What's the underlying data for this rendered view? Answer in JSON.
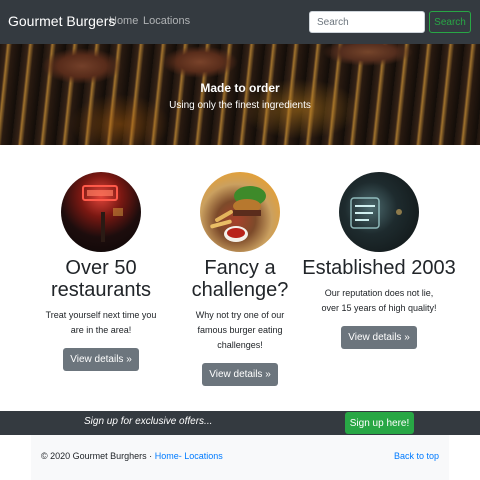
{
  "navbar": {
    "brand": "Gourmet Burgers",
    "links": [
      "Home",
      "Locations"
    ],
    "search": {
      "placeholder": "Search",
      "button_label": "Search"
    }
  },
  "hero": {
    "title": "Made to order",
    "subtitle": "Using only the finest ingredients"
  },
  "features": [
    {
      "heading": "Over 50 restaurants",
      "text_lines": [
        "Treat yourself next time you",
        "are in the area!"
      ],
      "button_label": "View details »"
    },
    {
      "heading": "Fancy a challenge?",
      "text_lines": [
        "Why not try one of our",
        "famous burger eating",
        "challenges!"
      ],
      "button_label": "View details »"
    },
    {
      "heading": "Established 2003",
      "text_lines": [
        "Our reputation does not lie,",
        "over 15 years of high quality!"
      ],
      "button_label": "View details »"
    }
  ],
  "signup": {
    "text": "Sign up for exclusive offers...",
    "button_label": "Sign up here!"
  },
  "footer": {
    "copyright": "© 2020 Gourmet Burghers ·",
    "links": [
      "Home",
      "- Locations"
    ],
    "back_to_top": "Back to top"
  },
  "colors": {
    "navbar": "#343a40",
    "accent_green": "#28a745",
    "button_gray": "#6c757d",
    "link_blue": "#007bff",
    "footer_bg": "#f8f9fa"
  },
  "icons": [
    "open-sign-photo",
    "burger-fries-photo",
    "neon-sign-photo"
  ]
}
